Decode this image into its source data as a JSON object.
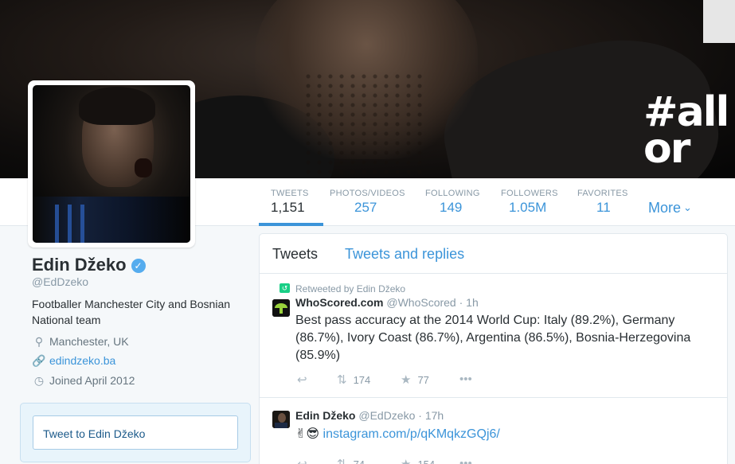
{
  "banner": {
    "hashtag_text": "#all or"
  },
  "nav": {
    "stats": [
      {
        "label": "TWEETS",
        "value": "1,151",
        "active": true
      },
      {
        "label": "PHOTOS/VIDEOS",
        "value": "257"
      },
      {
        "label": "FOLLOWING",
        "value": "149"
      },
      {
        "label": "FOLLOWERS",
        "value": "1.05M"
      },
      {
        "label": "FAVORITES",
        "value": "11"
      }
    ],
    "more_label": "More",
    "more_icon": "chevron-down-icon"
  },
  "profile": {
    "name": "Edin Džeko",
    "verified_icon": "verified-badge-icon",
    "handle": "@EdDzeko",
    "bio": "Footballer Manchester City and Bosnian National team",
    "location": "Manchester, UK",
    "website": "edindzeko.ba",
    "joined": "Joined April 2012"
  },
  "tweet_to": {
    "placeholder": "Tweet to Edin Džeko"
  },
  "timeline": {
    "tabs": [
      "Tweets",
      "Tweets and replies"
    ],
    "tweets": [
      {
        "retweeted_by": "Retweeted by Edin Džeko",
        "author": "WhoScored.com",
        "handle": "@WhoScored",
        "time": "· 1h",
        "text": "Best pass accuracy at the 2014 World Cup: Italy (89.2%), Germany (86.7%), Ivory Coast (86.7%), Argentina (86.5%), Bosnia-Herzegovina (85.9%)",
        "retweets": "174",
        "favorites": "77"
      },
      {
        "author": "Edin Džeko",
        "handle": "@EdDzeko",
        "time": "· 17h",
        "emoji": "✌😎",
        "link": "instagram.com/p/qKMqkzGQj6/",
        "retweets": "74",
        "favorites": "154"
      }
    ]
  },
  "colors": {
    "accent": "#3b94d9",
    "retweet_green": "#19cf86",
    "verified_blue": "#55acee"
  }
}
